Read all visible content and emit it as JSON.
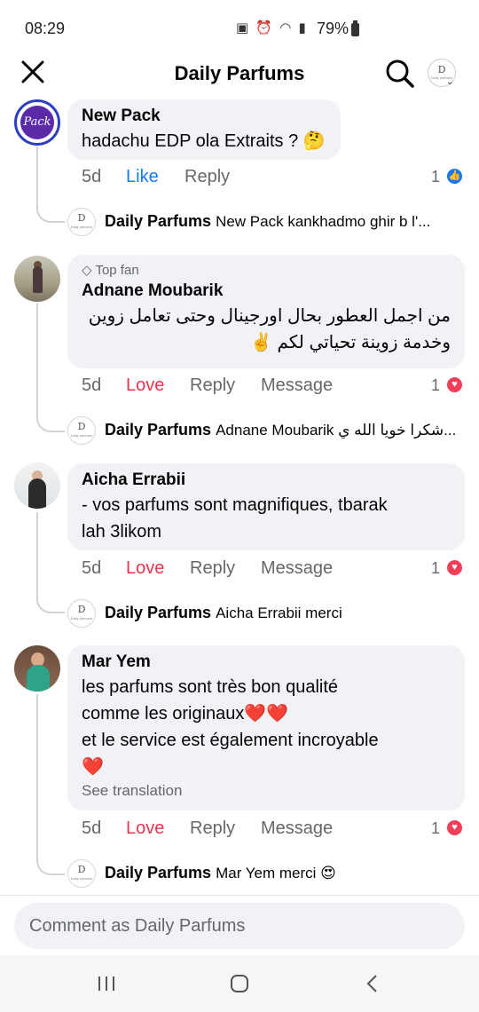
{
  "status_bar": {
    "time": "08:29",
    "battery": "79%",
    "icons": [
      "battery-saver-icon",
      "alarm-icon",
      "wifi-icon",
      "signal-icon",
      "battery-icon"
    ]
  },
  "header": {
    "title": "Daily Parfums",
    "close_icon": "close-icon",
    "search_icon": "search-icon",
    "page_avatar_mono": "D",
    "page_avatar_caption": "Daily parfums"
  },
  "comments": [
    {
      "author": "New Pack",
      "avatar_text": "Pack",
      "badge": "",
      "lines": [
        "hadachu EDP ola Extraits ? 🤔"
      ],
      "time": "5d",
      "react_label": "Like",
      "reply_label": "Reply",
      "message_label": "",
      "reaction_count": "1",
      "reaction_type": "like",
      "reply": {
        "author": "Daily Parfums",
        "snippet": "New Pack kankhadmo ghir b l'..."
      }
    },
    {
      "author": "Adnane Moubarik",
      "badge": "Top fan",
      "lines": [
        "من اجمل العطور بحال اورجينال وحتى تعامل زوين",
        "وخدمة زوينة تحياتي لكم ✌️"
      ],
      "time": "5d",
      "react_label": "Love",
      "reply_label": "Reply",
      "message_label": "Message",
      "reaction_count": "1",
      "reaction_type": "love",
      "reply": {
        "author": "Daily Parfums",
        "snippet": "Adnane Moubarik شكرا خويا الله ي..."
      }
    },
    {
      "author": "Aicha Errabii",
      "badge": "",
      "lines": [
        "- vos parfums sont magnifiques,  tbarak",
        "lah 3likom"
      ],
      "time": "5d",
      "react_label": "Love",
      "reply_label": "Reply",
      "message_label": "Message",
      "reaction_count": "1",
      "reaction_type": "love",
      "reply": {
        "author": "Daily Parfums",
        "snippet": "Aicha Errabii merci"
      }
    },
    {
      "author": "Mar Yem",
      "badge": "",
      "lines": [
        "les parfums sont très bon qualité",
        "comme les originaux❤️❤️",
        "et le service est également  incroyable",
        "❤️"
      ],
      "see_translation": "See translation",
      "time": "5d",
      "react_label": "Love",
      "reply_label": "Reply",
      "message_label": "Message",
      "reaction_count": "1",
      "reaction_type": "love",
      "reply": {
        "author": "Daily Parfums",
        "snippet": "Mar Yem merci 😍"
      }
    }
  ],
  "composer": {
    "placeholder": "Comment as Daily Parfums"
  },
  "nav": {
    "recents": "recents-icon",
    "home": "home-icon",
    "back": "back-icon"
  },
  "colors": {
    "like": "#1877f2",
    "love": "#e8344e",
    "bubble": "#f0f2f5",
    "meta": "#65676b"
  }
}
